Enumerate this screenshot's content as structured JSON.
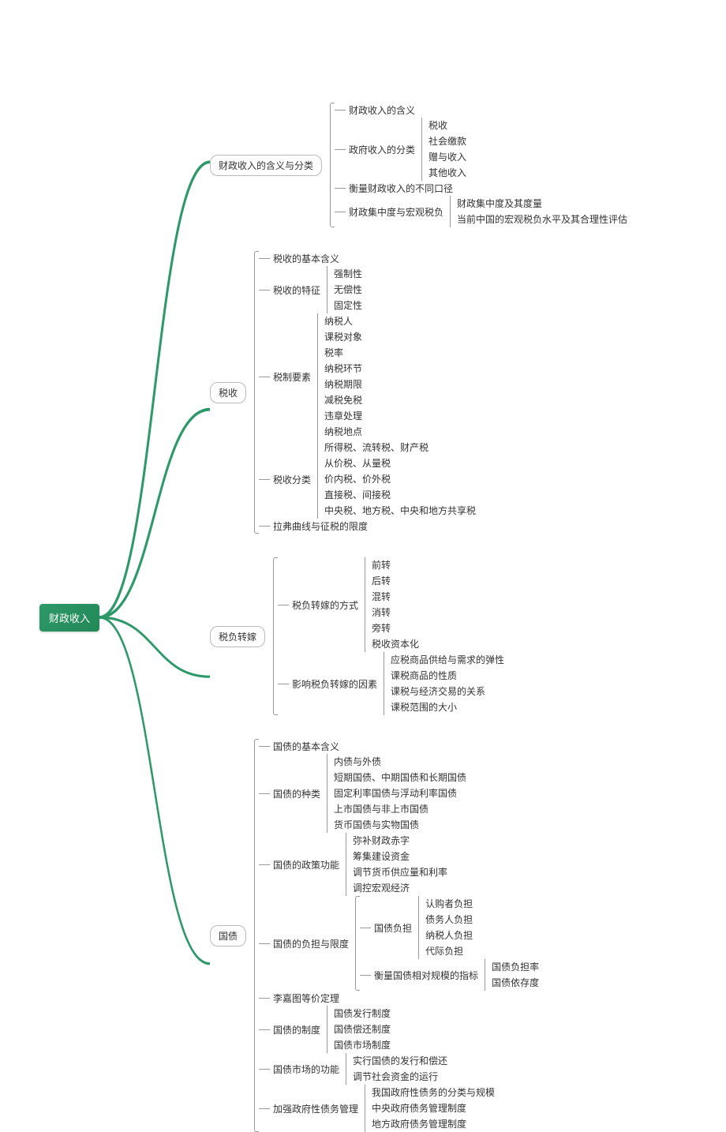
{
  "root": "财政收入",
  "b1": {
    "label": "财政收入的含义与分类",
    "s1": "财政收入的含义",
    "s2": {
      "label": "政府收入的分类",
      "items": [
        "税收",
        "社会缴款",
        "赠与收入",
        "其他收入"
      ]
    },
    "s3": "衡量财政收入的不同口径",
    "s4": {
      "label": "财政集中度与宏观税负",
      "items": [
        "财政集中度及其度量",
        "当前中国的宏观税负水平及其合理性评估"
      ]
    }
  },
  "b2": {
    "label": "税收",
    "s1": "税收的基本含义",
    "s2": {
      "label": "税收的特征",
      "items": [
        "强制性",
        "无偿性",
        "固定性"
      ]
    },
    "s3": {
      "label": "税制要素",
      "items": [
        "纳税人",
        "课税对象",
        "税率",
        "纳税环节",
        "纳税期限",
        "减税免税",
        "违章处理",
        "纳税地点"
      ]
    },
    "s4": {
      "label": "税收分类",
      "items": [
        "所得税、流转税、财产税",
        "从价税、从量税",
        "价内税、价外税",
        "直接税、间接税",
        "中央税、地方税、中央和地方共享税"
      ]
    },
    "s5": "拉弗曲线与征税的限度"
  },
  "b3": {
    "label": "税负转嫁",
    "s1": {
      "label": "税负转嫁的方式",
      "items": [
        "前转",
        "后转",
        "混转",
        "消转",
        "旁转",
        "税收资本化"
      ]
    },
    "s2": {
      "label": "影响税负转嫁的因素",
      "items": [
        "应税商品供给与需求的弹性",
        "课税商品的性质",
        "课税与经济交易的关系",
        "课税范围的大小"
      ]
    }
  },
  "b4": {
    "label": "国债",
    "s1": "国债的基本含义",
    "s2": {
      "label": "国债的种类",
      "items": [
        "内债与外债",
        "短期国债、中期国债和长期国债",
        "固定利率国债与浮动利率国债",
        "上市国债与非上市国债",
        "货币国债与实物国债"
      ]
    },
    "s3": {
      "label": "国债的政策功能",
      "items": [
        "弥补财政赤字",
        "筹集建设资金",
        "调节货币供应量和利率",
        "调控宏观经济"
      ]
    },
    "s4": {
      "label": "国债的负担与限度",
      "sub1": {
        "label": "国债负担",
        "items": [
          "认购者负担",
          "债务人负担",
          "纳税人负担",
          "代际负担"
        ]
      },
      "sub2": {
        "label": "衡量国债相对规模的指标",
        "items": [
          "国债负担率",
          "国债依存度"
        ]
      }
    },
    "s5": "李嘉图等价定理",
    "s6": {
      "label": "国债的制度",
      "items": [
        "国债发行制度",
        "国债偿还制度",
        "国债市场制度"
      ]
    },
    "s7": {
      "label": "国债市场的功能",
      "items": [
        "实行国债的发行和偿还",
        "调节社会资金的运行"
      ]
    },
    "s8": {
      "label": "加强政府性债务管理",
      "items": [
        "我国政府性债务的分类与规模",
        "中央政府债务管理制度",
        "地方政府债务管理制度"
      ]
    }
  }
}
